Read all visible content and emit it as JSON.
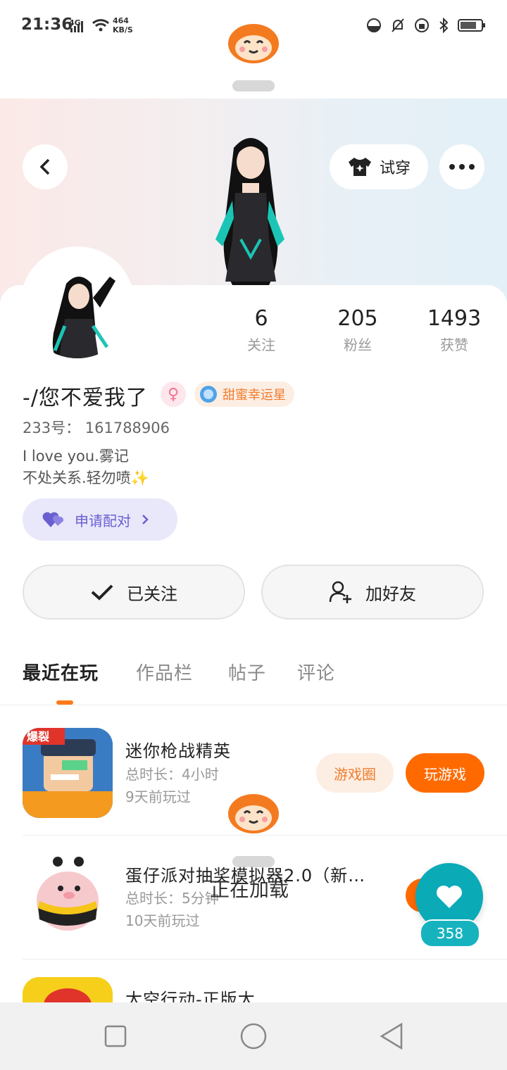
{
  "status_bar": {
    "time": "21:36",
    "network": "4G",
    "speed_value": "464",
    "speed_unit": "KB/S"
  },
  "header": {
    "tryon_label": "试穿"
  },
  "profile": {
    "stats": [
      {
        "value": "6",
        "label": "关注"
      },
      {
        "value": "205",
        "label": "粉丝"
      },
      {
        "value": "1493",
        "label": "获赞"
      }
    ],
    "nickname": "-/您不爱我了",
    "gender_symbol": "♀",
    "title_badge": "甜蜜幸运星",
    "uid": "233号： 161788906",
    "bio_line1": "I love you.雾记",
    "bio_line2": "不处关系.轻勿喷✨",
    "pair_label": "申请配对",
    "followed_label": "已关注",
    "add_friend_label": "加好友"
  },
  "tabs": [
    {
      "label": "最近在玩",
      "active": true
    },
    {
      "label": "作品栏",
      "active": false
    },
    {
      "label": "帖子",
      "active": false
    },
    {
      "label": "评论",
      "active": false
    }
  ],
  "games": [
    {
      "title": "迷你枪战精英",
      "duration": "总时长：4小时",
      "last_played": "9天前玩过",
      "icon_text": "爆裂",
      "circle_label": "游戏圈",
      "play_label": "玩游戏"
    },
    {
      "title": "蛋仔派对抽奖模拟器2.0（新…",
      "duration": "总时长：5分钟",
      "last_played": "10天前玩过"
    },
    {
      "title": "太空行动-正版太…"
    }
  ],
  "like": {
    "count": "358"
  },
  "loading_text": "正在加载",
  "colors": {
    "accent": "#ff6a00",
    "like": "#0aaab7",
    "pair": "#6a5fd0"
  }
}
